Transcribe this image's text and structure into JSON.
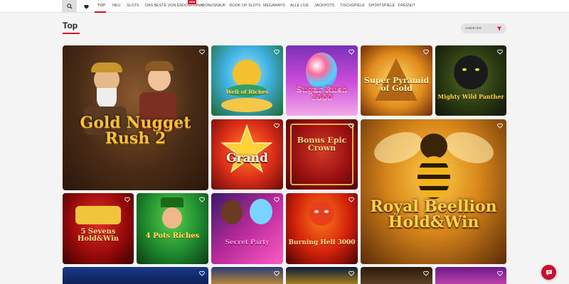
{
  "nav": {
    "items": [
      {
        "label": "TOP"
      },
      {
        "label": "NEU"
      },
      {
        "label": "SLOTS"
      },
      {
        "label": "DAS BESTE VON ENDORPHINA"
      },
      {
        "label": "BONUSKAUF"
      },
      {
        "label": "BOOK OF SLOTS"
      },
      {
        "label": "MEGAWAYS"
      },
      {
        "label": "ALLE LIVE"
      },
      {
        "label": "JACKPOTS"
      },
      {
        "label": "TISCHSPIELE"
      },
      {
        "label": "SPORTSPIELE"
      },
      {
        "label": "FREIZEIT"
      }
    ],
    "new_badge": "NEW"
  },
  "section": {
    "title": "Top",
    "sort_label": "ANBIETER"
  },
  "games": [
    {
      "title": "Gold Nugget Rush 2"
    },
    {
      "title": "Well of Riches"
    },
    {
      "title": "Sugar Rush 1000"
    },
    {
      "title": "Super Pyramid of Gold"
    },
    {
      "title": "Mighty Wild Panther"
    },
    {
      "title": "Grand"
    },
    {
      "title": "Bonus Epic Crown"
    },
    {
      "title": "Royal Beellion Hold&Win"
    },
    {
      "title": "5 Sevens Hold&Win"
    },
    {
      "title": "4 Pots Riches"
    },
    {
      "title": "Secret Party"
    },
    {
      "title": "Burning Hell 3000"
    }
  ],
  "colors": {
    "accent": "#d0102a"
  }
}
